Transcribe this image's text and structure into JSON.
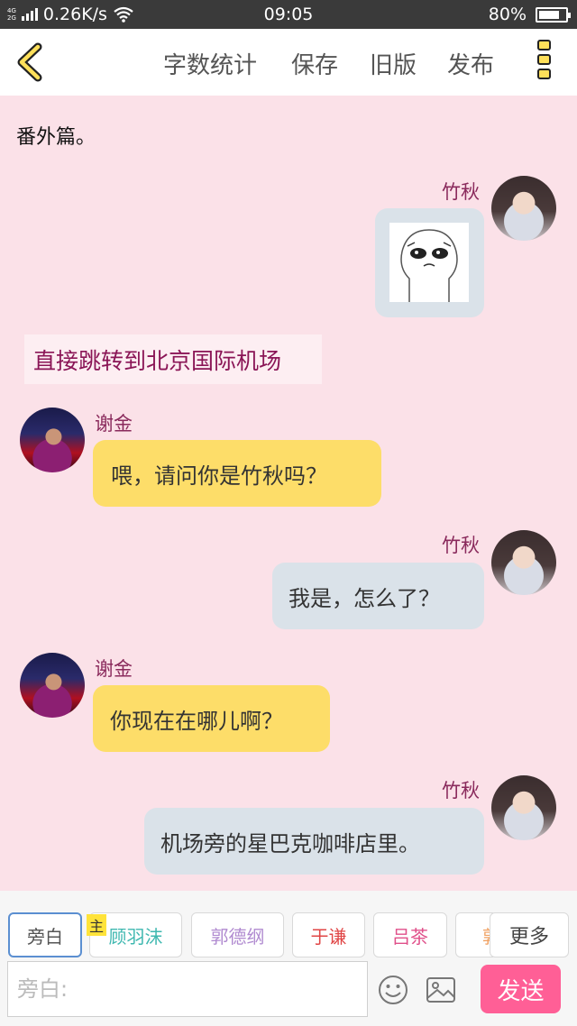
{
  "status_bar": {
    "network": "4G",
    "network2": "2G",
    "speed": "0.26K/s",
    "time": "09:05",
    "battery": "80%"
  },
  "toolbar": {
    "word_count_label": "字数统计",
    "save_label": "保存",
    "old_version_label": "旧版",
    "publish_label": "发布"
  },
  "chat": {
    "top_narration": "番外篇。",
    "messages": [
      {
        "speaker": "竹秋",
        "type": "image"
      },
      {
        "type": "narration",
        "text": "直接跳转到北京国际机场"
      },
      {
        "speaker": "谢金",
        "text": "喂，请问你是竹秋吗？"
      },
      {
        "speaker": "竹秋",
        "text": "我是，怎么了？"
      },
      {
        "speaker": "谢金",
        "text": "你现在在哪儿啊？"
      },
      {
        "speaker": "竹秋",
        "text": "机场旁的星巴克咖啡店里。"
      }
    ]
  },
  "input_area": {
    "roles": [
      {
        "label": "旁白",
        "color": "#555555"
      },
      {
        "label": "顾羽沫",
        "color": "#3fb8b0"
      },
      {
        "label": "郭德纲",
        "color": "#b08ad0"
      },
      {
        "label": "于谦",
        "color": "#e04646"
      },
      {
        "label": "吕茶",
        "color": "#e0508a"
      },
      {
        "label": "郭",
        "color": "#f0a060"
      }
    ],
    "main_badge": "主",
    "more_label": "更多",
    "input_placeholder": "旁白:",
    "send_label": "发送"
  }
}
